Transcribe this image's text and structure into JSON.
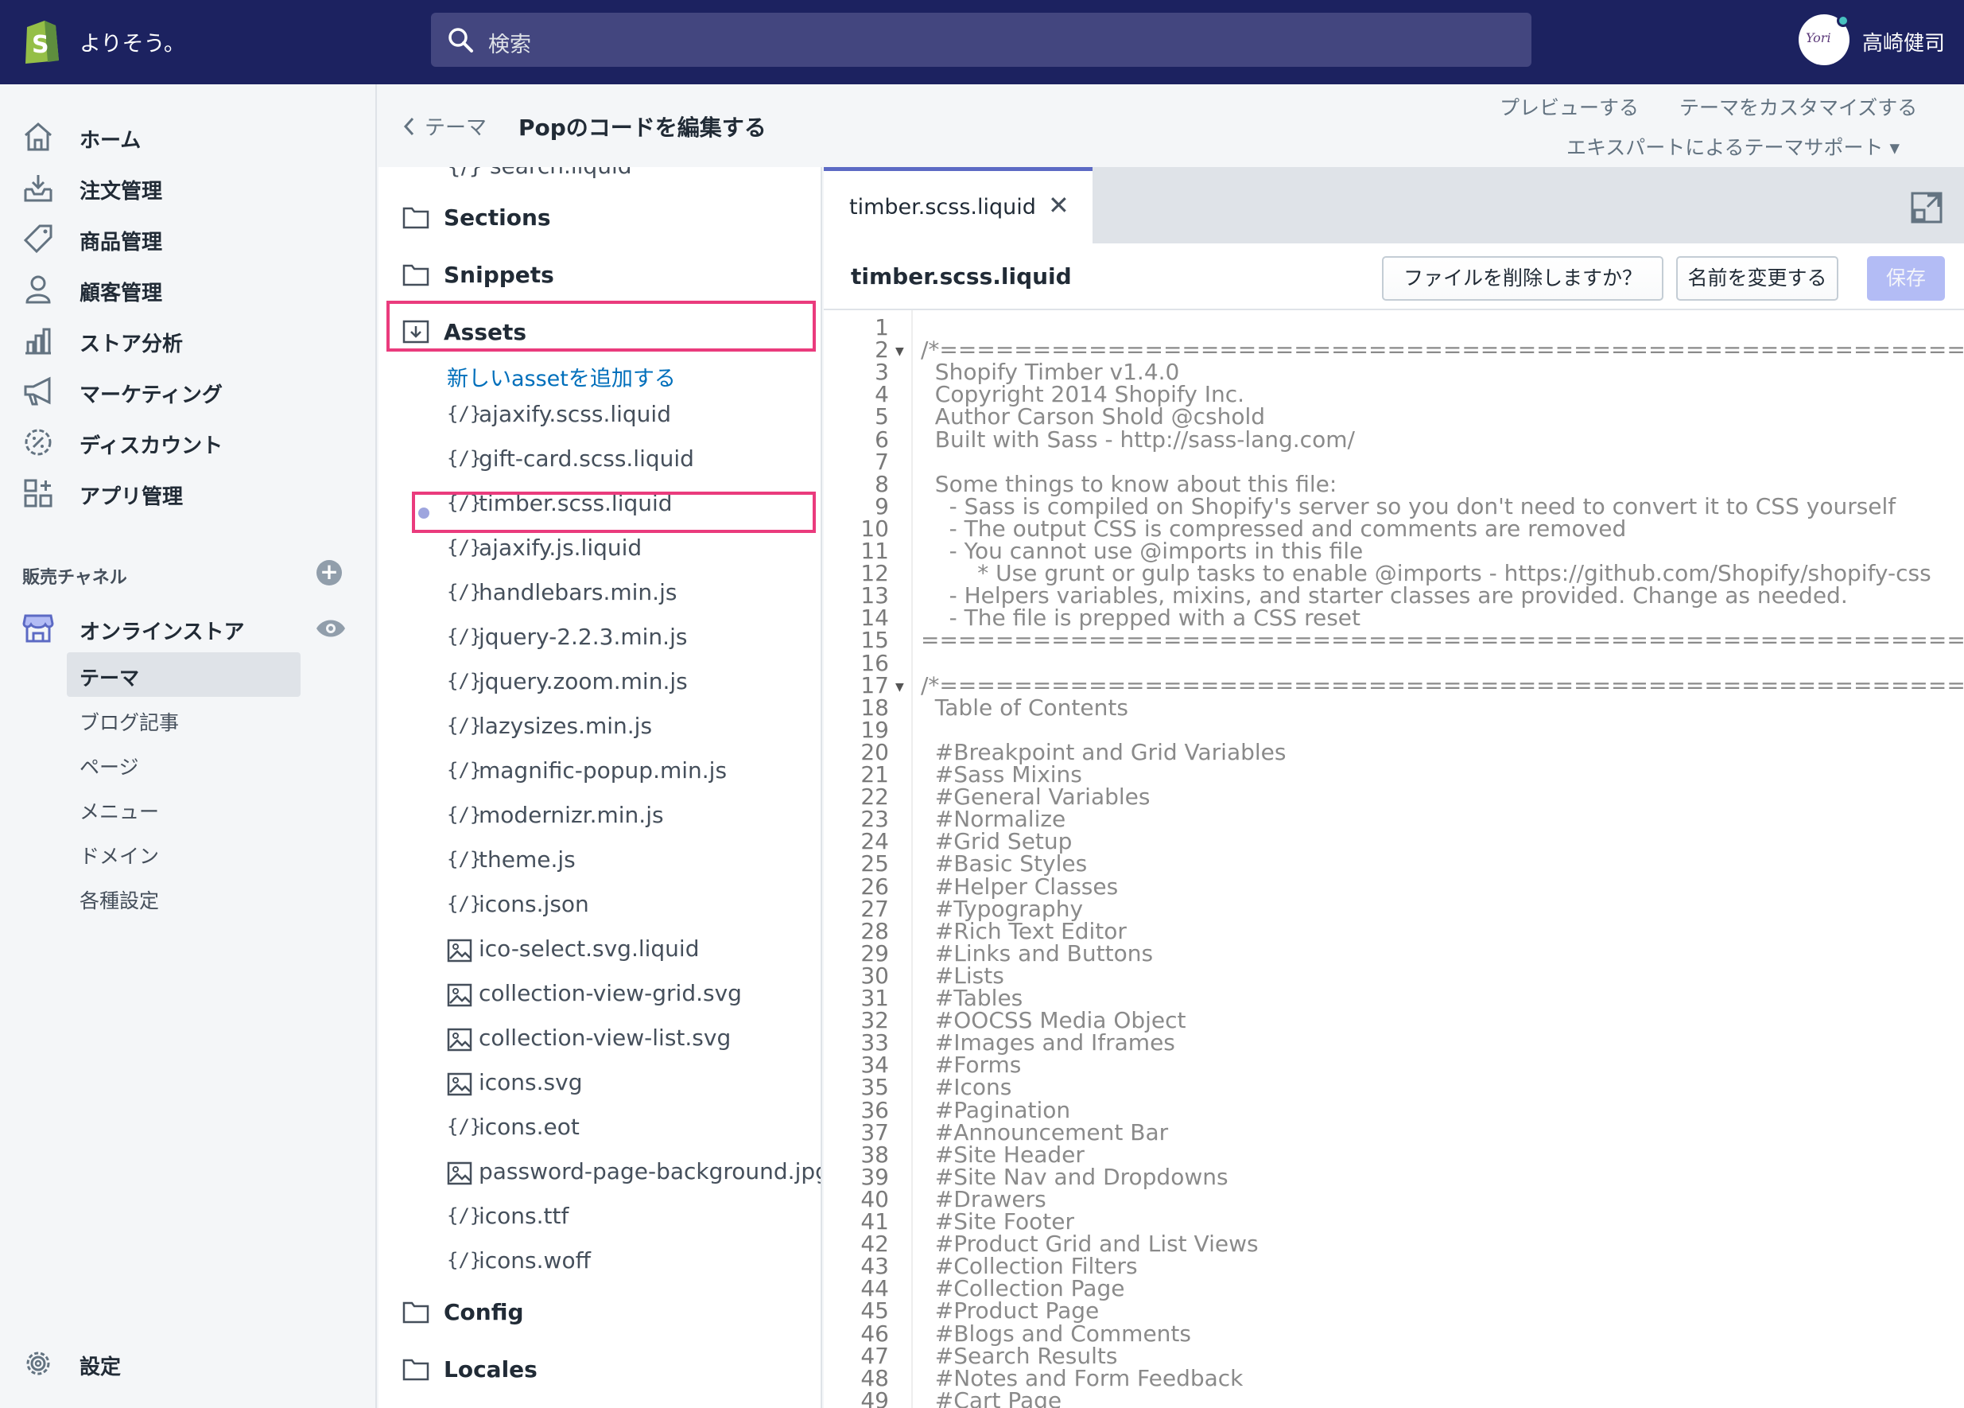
{
  "topbar": {
    "store_name": "よりそう。",
    "search_placeholder": "検索",
    "avatar_text": "Yori",
    "user_name": "高崎健司"
  },
  "sidebar": {
    "items": [
      {
        "label": "ホーム",
        "icon": "home-icon"
      },
      {
        "label": "注文管理",
        "icon": "orders-icon"
      },
      {
        "label": "商品管理",
        "icon": "tag-icon"
      },
      {
        "label": "顧客管理",
        "icon": "customer-icon"
      },
      {
        "label": "ストア分析",
        "icon": "analytics-icon"
      },
      {
        "label": "マーケティング",
        "icon": "megaphone-icon"
      },
      {
        "label": "ディスカウント",
        "icon": "discount-icon"
      },
      {
        "label": "アプリ管理",
        "icon": "apps-icon"
      }
    ],
    "channels_label": "販売チャネル",
    "online_store": "オンラインストア",
    "sub_items": [
      "テーマ",
      "ブログ記事",
      "ページ",
      "メニュー",
      "ドメイン",
      "各種設定"
    ],
    "settings": "設定"
  },
  "header": {
    "breadcrumb": "テーマ",
    "title": "Popのコードを編集する",
    "preview": "プレビューする",
    "customize": "テーマをカスタマイズする",
    "support": "エキスパートによるテーマサポート ▾"
  },
  "filetree": {
    "cut_item": "{/} search.liquid",
    "folders": {
      "sections": "Sections",
      "snippets": "Snippets",
      "assets": "Assets",
      "config": "Config",
      "locales": "Locales"
    },
    "add_asset": "新しいassetを追加する",
    "files": [
      {
        "name": "ajaxify.scss.liquid",
        "type": "code"
      },
      {
        "name": "gift-card.scss.liquid",
        "type": "code"
      },
      {
        "name": "timber.scss.liquid",
        "type": "code"
      },
      {
        "name": "ajaxify.js.liquid",
        "type": "code"
      },
      {
        "name": "handlebars.min.js",
        "type": "code"
      },
      {
        "name": "jquery-2.2.3.min.js",
        "type": "code"
      },
      {
        "name": "jquery.zoom.min.js",
        "type": "code"
      },
      {
        "name": "lazysizes.min.js",
        "type": "code"
      },
      {
        "name": "magnific-popup.min.js",
        "type": "code"
      },
      {
        "name": "modernizr.min.js",
        "type": "code"
      },
      {
        "name": "theme.js",
        "type": "code"
      },
      {
        "name": "icons.json",
        "type": "code"
      },
      {
        "name": "ico-select.svg.liquid",
        "type": "image"
      },
      {
        "name": "collection-view-grid.svg",
        "type": "image"
      },
      {
        "name": "collection-view-list.svg",
        "type": "image"
      },
      {
        "name": "icons.svg",
        "type": "image"
      },
      {
        "name": "icons.eot",
        "type": "code"
      },
      {
        "name": "password-page-background.jpg",
        "type": "image"
      },
      {
        "name": "icons.ttf",
        "type": "code"
      },
      {
        "name": "icons.woff",
        "type": "code"
      }
    ]
  },
  "editor": {
    "tab_label": "timber.scss.liquid",
    "file_name": "timber.scss.liquid",
    "delete_btn": "ファイルを削除しますか？",
    "rename_btn": "名前を変更する",
    "save_btn": "保存",
    "lines": [
      "",
      "/*============================================================================",
      "  Shopify Timber v1.4.0",
      "  Copyright 2014 Shopify Inc.",
      "  Author Carson Shold @cshold",
      "  Built with Sass - http://sass-lang.com/",
      "",
      "  Some things to know about this file:",
      "    - Sass is compiled on Shopify's server so you don't need to convert it to CSS yourself",
      "    - The output CSS is compressed and comments are removed",
      "    - You cannot use @imports in this file",
      "        * Use grunt or gulp tasks to enable @imports - https://github.com/Shopify/shopify-css",
      "    - Helpers variables, mixins, and starter classes are provided. Change as needed.",
      "    - The file is prepped with a CSS reset",
      "==============================================================================",
      "",
      "/*============================================================================",
      "  Table of Contents",
      "",
      "  #Breakpoint and Grid Variables",
      "  #Sass Mixins",
      "  #General Variables",
      "  #Normalize",
      "  #Grid Setup",
      "  #Basic Styles",
      "  #Helper Classes",
      "  #Typography",
      "  #Rich Text Editor",
      "  #Links and Buttons",
      "  #Lists",
      "  #Tables",
      "  #OOCSS Media Object",
      "  #Images and Iframes",
      "  #Forms",
      "  #Icons",
      "  #Pagination",
      "  #Announcement Bar",
      "  #Site Header",
      "  #Site Nav and Dropdowns",
      "  #Drawers",
      "  #Site Footer",
      "  #Product Grid and List Views",
      "  #Collection Filters",
      "  #Collection Page",
      "  #Product Page",
      "  #Blogs and Comments",
      "  #Search Results",
      "  #Notes and Form Feedback",
      "  #Cart Page"
    ]
  },
  "colors": {
    "topbar": "#1c2260",
    "highlight": "#ea3b7d",
    "link": "#006fbb",
    "save_disabled": "#b3bcf5",
    "tab_accent": "#5c6ac4"
  }
}
